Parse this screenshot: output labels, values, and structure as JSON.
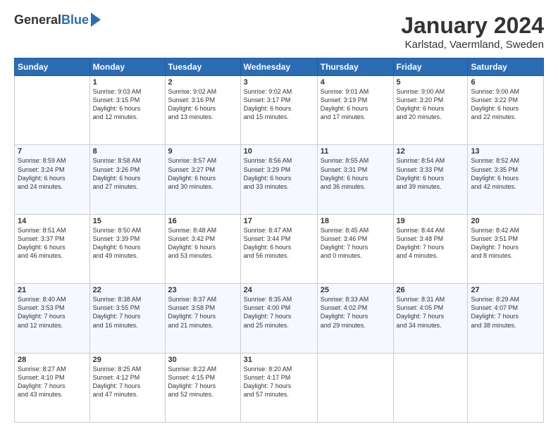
{
  "header": {
    "logo_general": "General",
    "logo_blue": "Blue",
    "month_title": "January 2024",
    "location": "Karlstad, Vaermland, Sweden"
  },
  "weekdays": [
    "Sunday",
    "Monday",
    "Tuesday",
    "Wednesday",
    "Thursday",
    "Friday",
    "Saturday"
  ],
  "weeks": [
    [
      {
        "day": "",
        "sunrise": "",
        "sunset": "",
        "daylight": ""
      },
      {
        "day": "1",
        "sunrise": "Sunrise: 9:03 AM",
        "sunset": "Sunset: 3:15 PM",
        "daylight": "Daylight: 6 hours and 12 minutes."
      },
      {
        "day": "2",
        "sunrise": "Sunrise: 9:02 AM",
        "sunset": "Sunset: 3:16 PM",
        "daylight": "Daylight: 6 hours and 13 minutes."
      },
      {
        "day": "3",
        "sunrise": "Sunrise: 9:02 AM",
        "sunset": "Sunset: 3:17 PM",
        "daylight": "Daylight: 6 hours and 15 minutes."
      },
      {
        "day": "4",
        "sunrise": "Sunrise: 9:01 AM",
        "sunset": "Sunset: 3:19 PM",
        "daylight": "Daylight: 6 hours and 17 minutes."
      },
      {
        "day": "5",
        "sunrise": "Sunrise: 9:00 AM",
        "sunset": "Sunset: 3:20 PM",
        "daylight": "Daylight: 6 hours and 20 minutes."
      },
      {
        "day": "6",
        "sunrise": "Sunrise: 9:00 AM",
        "sunset": "Sunset: 3:22 PM",
        "daylight": "Daylight: 6 hours and 22 minutes."
      }
    ],
    [
      {
        "day": "7",
        "sunrise": "Sunrise: 8:59 AM",
        "sunset": "Sunset: 3:24 PM",
        "daylight": "Daylight: 6 hours and 24 minutes."
      },
      {
        "day": "8",
        "sunrise": "Sunrise: 8:58 AM",
        "sunset": "Sunset: 3:26 PM",
        "daylight": "Daylight: 6 hours and 27 minutes."
      },
      {
        "day": "9",
        "sunrise": "Sunrise: 8:57 AM",
        "sunset": "Sunset: 3:27 PM",
        "daylight": "Daylight: 6 hours and 30 minutes."
      },
      {
        "day": "10",
        "sunrise": "Sunrise: 8:56 AM",
        "sunset": "Sunset: 3:29 PM",
        "daylight": "Daylight: 6 hours and 33 minutes."
      },
      {
        "day": "11",
        "sunrise": "Sunrise: 8:55 AM",
        "sunset": "Sunset: 3:31 PM",
        "daylight": "Daylight: 6 hours and 36 minutes."
      },
      {
        "day": "12",
        "sunrise": "Sunrise: 8:54 AM",
        "sunset": "Sunset: 3:33 PM",
        "daylight": "Daylight: 6 hours and 39 minutes."
      },
      {
        "day": "13",
        "sunrise": "Sunrise: 8:52 AM",
        "sunset": "Sunset: 3:35 PM",
        "daylight": "Daylight: 6 hours and 42 minutes."
      }
    ],
    [
      {
        "day": "14",
        "sunrise": "Sunrise: 8:51 AM",
        "sunset": "Sunset: 3:37 PM",
        "daylight": "Daylight: 6 hours and 46 minutes."
      },
      {
        "day": "15",
        "sunrise": "Sunrise: 8:50 AM",
        "sunset": "Sunset: 3:39 PM",
        "daylight": "Daylight: 6 hours and 49 minutes."
      },
      {
        "day": "16",
        "sunrise": "Sunrise: 8:48 AM",
        "sunset": "Sunset: 3:42 PM",
        "daylight": "Daylight: 6 hours and 53 minutes."
      },
      {
        "day": "17",
        "sunrise": "Sunrise: 8:47 AM",
        "sunset": "Sunset: 3:44 PM",
        "daylight": "Daylight: 6 hours and 56 minutes."
      },
      {
        "day": "18",
        "sunrise": "Sunrise: 8:45 AM",
        "sunset": "Sunset: 3:46 PM",
        "daylight": "Daylight: 7 hours and 0 minutes."
      },
      {
        "day": "19",
        "sunrise": "Sunrise: 8:44 AM",
        "sunset": "Sunset: 3:48 PM",
        "daylight": "Daylight: 7 hours and 4 minutes."
      },
      {
        "day": "20",
        "sunrise": "Sunrise: 8:42 AM",
        "sunset": "Sunset: 3:51 PM",
        "daylight": "Daylight: 7 hours and 8 minutes."
      }
    ],
    [
      {
        "day": "21",
        "sunrise": "Sunrise: 8:40 AM",
        "sunset": "Sunset: 3:53 PM",
        "daylight": "Daylight: 7 hours and 12 minutes."
      },
      {
        "day": "22",
        "sunrise": "Sunrise: 8:38 AM",
        "sunset": "Sunset: 3:55 PM",
        "daylight": "Daylight: 7 hours and 16 minutes."
      },
      {
        "day": "23",
        "sunrise": "Sunrise: 8:37 AM",
        "sunset": "Sunset: 3:58 PM",
        "daylight": "Daylight: 7 hours and 21 minutes."
      },
      {
        "day": "24",
        "sunrise": "Sunrise: 8:35 AM",
        "sunset": "Sunset: 4:00 PM",
        "daylight": "Daylight: 7 hours and 25 minutes."
      },
      {
        "day": "25",
        "sunrise": "Sunrise: 8:33 AM",
        "sunset": "Sunset: 4:02 PM",
        "daylight": "Daylight: 7 hours and 29 minutes."
      },
      {
        "day": "26",
        "sunrise": "Sunrise: 8:31 AM",
        "sunset": "Sunset: 4:05 PM",
        "daylight": "Daylight: 7 hours and 34 minutes."
      },
      {
        "day": "27",
        "sunrise": "Sunrise: 8:29 AM",
        "sunset": "Sunset: 4:07 PM",
        "daylight": "Daylight: 7 hours and 38 minutes."
      }
    ],
    [
      {
        "day": "28",
        "sunrise": "Sunrise: 8:27 AM",
        "sunset": "Sunset: 4:10 PM",
        "daylight": "Daylight: 7 hours and 43 minutes."
      },
      {
        "day": "29",
        "sunrise": "Sunrise: 8:25 AM",
        "sunset": "Sunset: 4:12 PM",
        "daylight": "Daylight: 7 hours and 47 minutes."
      },
      {
        "day": "30",
        "sunrise": "Sunrise: 8:22 AM",
        "sunset": "Sunset: 4:15 PM",
        "daylight": "Daylight: 7 hours and 52 minutes."
      },
      {
        "day": "31",
        "sunrise": "Sunrise: 8:20 AM",
        "sunset": "Sunset: 4:17 PM",
        "daylight": "Daylight: 7 hours and 57 minutes."
      },
      {
        "day": "",
        "sunrise": "",
        "sunset": "",
        "daylight": ""
      },
      {
        "day": "",
        "sunrise": "",
        "sunset": "",
        "daylight": ""
      },
      {
        "day": "",
        "sunrise": "",
        "sunset": "",
        "daylight": ""
      }
    ]
  ]
}
